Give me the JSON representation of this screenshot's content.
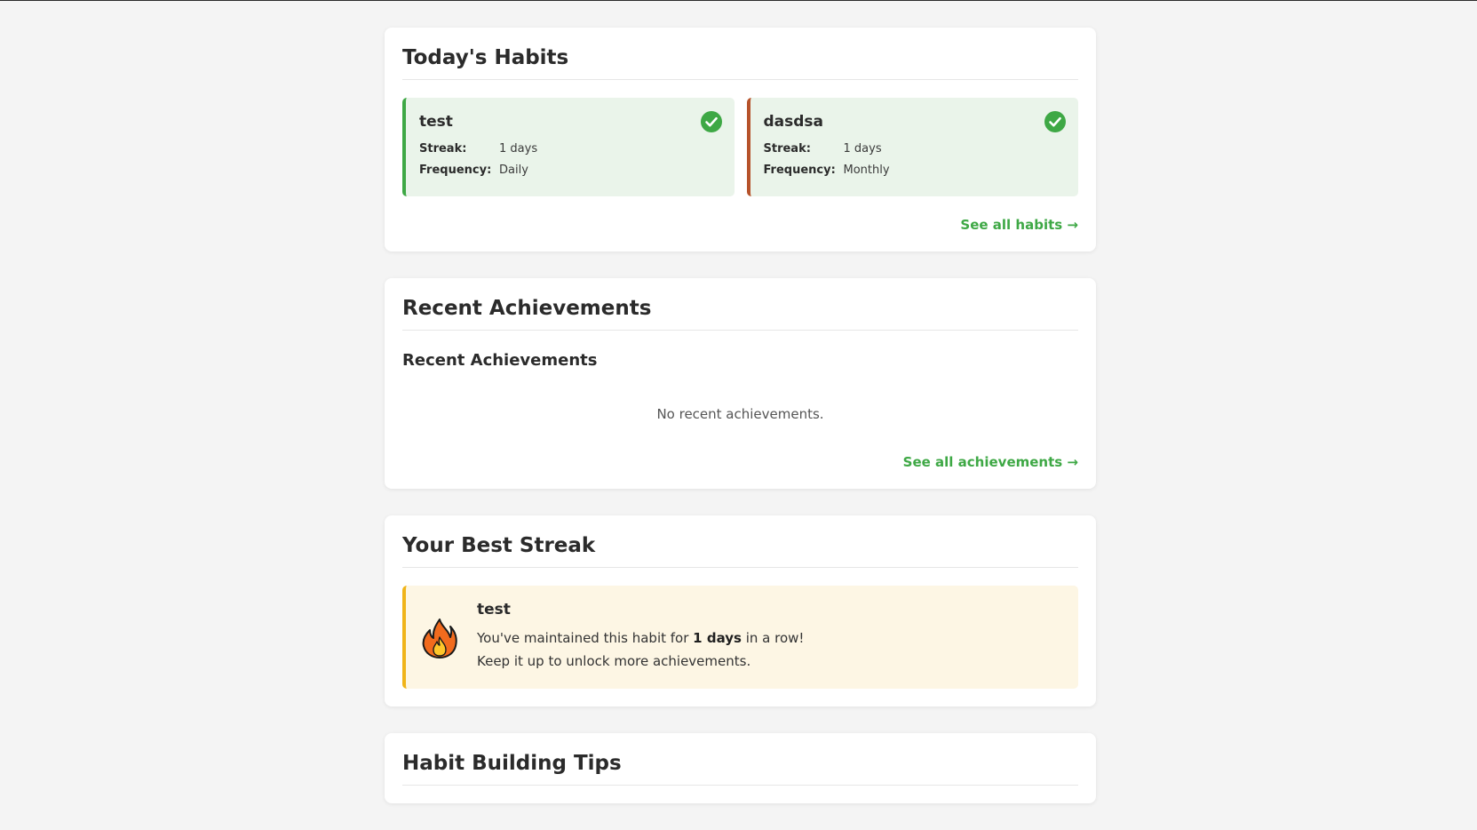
{
  "todays_habits": {
    "title": "Today's Habits",
    "habits": [
      {
        "name": "test",
        "streak_label": "Streak:",
        "streak_value": "1 days",
        "frequency_label": "Frequency:",
        "frequency_value": "Daily",
        "accent": "#3ea845",
        "completed": true,
        "status_icon": "check-circle-icon"
      },
      {
        "name": "dasdsa",
        "streak_label": "Streak:",
        "streak_value": "1 days",
        "frequency_label": "Frequency:",
        "frequency_value": "Monthly",
        "accent": "#b6522a",
        "completed": true,
        "status_icon": "check-circle-icon"
      }
    ],
    "see_all_label": "See all habits →"
  },
  "recent_achievements": {
    "title": "Recent Achievements",
    "subtitle": "Recent Achievements",
    "empty_message": "No recent achievements.",
    "see_all_label": "See all achievements →"
  },
  "best_streak": {
    "title": "Your Best Streak",
    "habit_name": "test",
    "icon": "fire-icon",
    "line1_prefix": "You've maintained this habit for ",
    "line1_value": "1 days",
    "line1_suffix": " in a row!",
    "line2": "Keep it up to unlock more achievements."
  },
  "tips": {
    "title": "Habit Building Tips"
  },
  "colors": {
    "accent_green": "#3ea845",
    "accent_brown": "#b6522a",
    "streak_accent": "#f0b419",
    "habit_card_bg": "#eaf4ea",
    "streak_bg": "#fdf6e4",
    "page_bg": "#f4f4f4"
  }
}
